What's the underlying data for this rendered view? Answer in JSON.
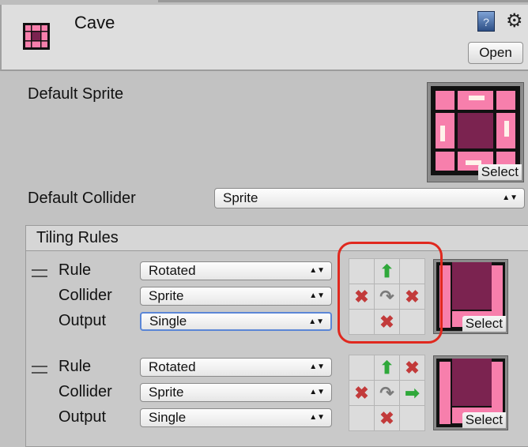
{
  "header": {
    "title": "Cave",
    "open_label": "Open",
    "help_icon": "help-book-icon",
    "settings_icon": "gear-icon"
  },
  "default_sprite": {
    "label": "Default Sprite",
    "select_label": "Select"
  },
  "default_collider": {
    "label": "Default Collider",
    "value": "Sprite"
  },
  "tiling_rules": {
    "title": "Tiling Rules",
    "rules": [
      {
        "rule_label": "Rule",
        "rule": "Rotated",
        "collider_label": "Collider",
        "collider": "Sprite",
        "output_label": "Output",
        "output": "Single",
        "select_label": "Select",
        "neighbors": [
          "",
          "arrow-up",
          "",
          "x",
          "rotate",
          "x",
          "",
          "x",
          ""
        ]
      },
      {
        "rule_label": "Rule",
        "rule": "Rotated",
        "collider_label": "Collider",
        "collider": "Sprite",
        "output_label": "Output",
        "output": "Single",
        "select_label": "Select",
        "neighbors": [
          "",
          "arrow-up",
          "x",
          "x",
          "rotate",
          "arrow-right",
          "",
          "x",
          ""
        ]
      }
    ]
  },
  "colors": {
    "highlight": "#e0281e",
    "focus": "#5b86d6",
    "pink": "#f77fac",
    "maroon": "#7b2350"
  }
}
